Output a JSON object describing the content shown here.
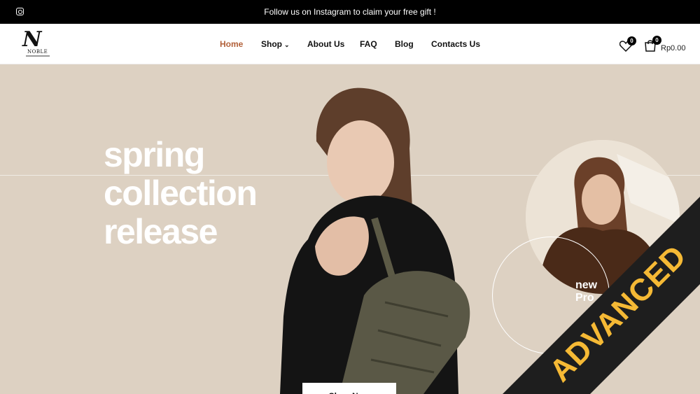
{
  "topbar": {
    "message": "Follow us on Instagram to claim your free gift !"
  },
  "header": {
    "logo_text": "NOBLE",
    "nav": [
      {
        "label": "Home",
        "active": true
      },
      {
        "label": "Shop",
        "active": false
      },
      {
        "label": "About Us",
        "active": false
      },
      {
        "label": "FAQ",
        "active": false
      },
      {
        "label": "Blog",
        "active": false
      },
      {
        "label": "Contacts Us",
        "active": false
      }
    ],
    "wishlist_count": "0",
    "cart_count": "0",
    "cart_total": "Rp0.00"
  },
  "hero": {
    "headline_1": "spring",
    "headline_2": "collection",
    "headline_3": "release",
    "badge_line_1": "new",
    "badge_line_2": "Pro",
    "button_label": "Shop Now"
  },
  "ribbon": {
    "label": "ADVANCED",
    "color": "#f5b935",
    "band_color": "#1e1e1e"
  },
  "colors": {
    "accent": "#b2613a",
    "hero_bg": "#ddd1c2"
  },
  "icons": [
    "instagram-icon",
    "heart-icon",
    "cart-icon",
    "chevron-down-icon"
  ]
}
